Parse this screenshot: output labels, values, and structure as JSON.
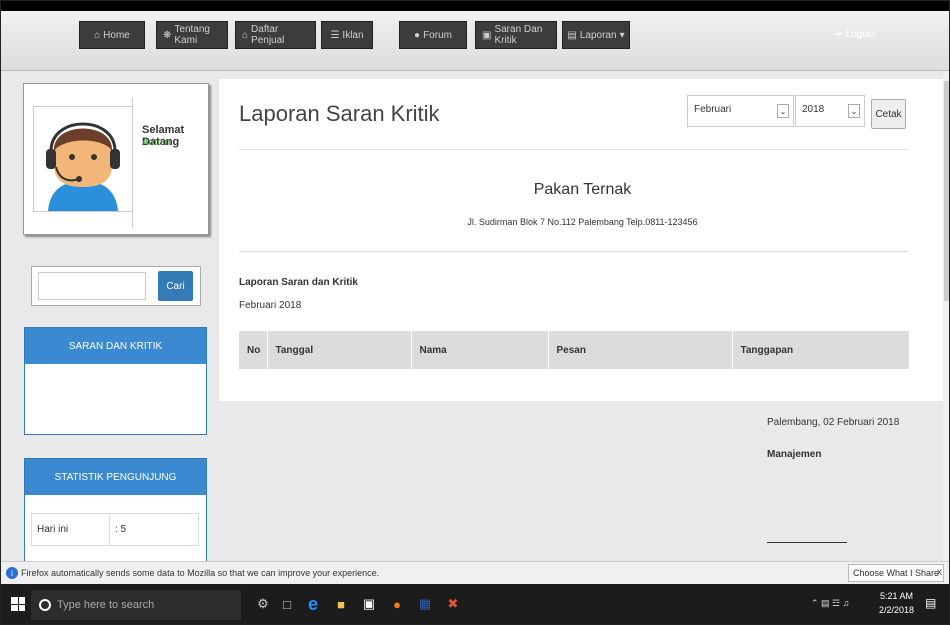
{
  "nav": {
    "home": "Home",
    "tentang": "Tentang Kami",
    "daftar": "Daftar Penjual",
    "iklan": "Iklan",
    "forum": "Forum",
    "saran": "Saran Dan Kritik",
    "laporan": "Laporan",
    "logout": "Logout"
  },
  "sidebar": {
    "welcome": "Selamat Datang",
    "role": "Admin",
    "search_button": "Cari",
    "saran_panel": "SARAN DAN KRITIK",
    "stat_panel": "STATISTIK PENGUNJUNG",
    "stats": [
      {
        "label": "Hari ini",
        "value": ": 5"
      }
    ]
  },
  "main": {
    "title": "Laporan Saran Kritik",
    "month": "Februari",
    "year": "2018",
    "print": "Cetak",
    "company": "Pakan Ternak",
    "address": "Jl. Sudirman Blok 7 No.112 Palembang Telp.0811-123456",
    "report_title": "Laporan Saran dan Kritik",
    "report_period": "Februari 2018",
    "columns": [
      "No",
      "Tanggal",
      "Nama",
      "Pesan",
      "Tanggapan"
    ]
  },
  "signature": {
    "place_date": "Palembang, 02 Februari 2018",
    "role": "Manajemen"
  },
  "notification": {
    "text": "Firefox automatically sends some data to Mozilla so that we can improve your experience.",
    "choose": "Choose What I Share",
    "close": "x"
  },
  "taskbar": {
    "search_placeholder": "Type here to search",
    "time": "5:21 AM",
    "date": "2/2/2018"
  },
  "colors": {
    "primary": "#337ab7",
    "panel_head": "#3b8ad1",
    "nav_button": "#3c3c3c",
    "admin_green": "#2aa32a"
  }
}
